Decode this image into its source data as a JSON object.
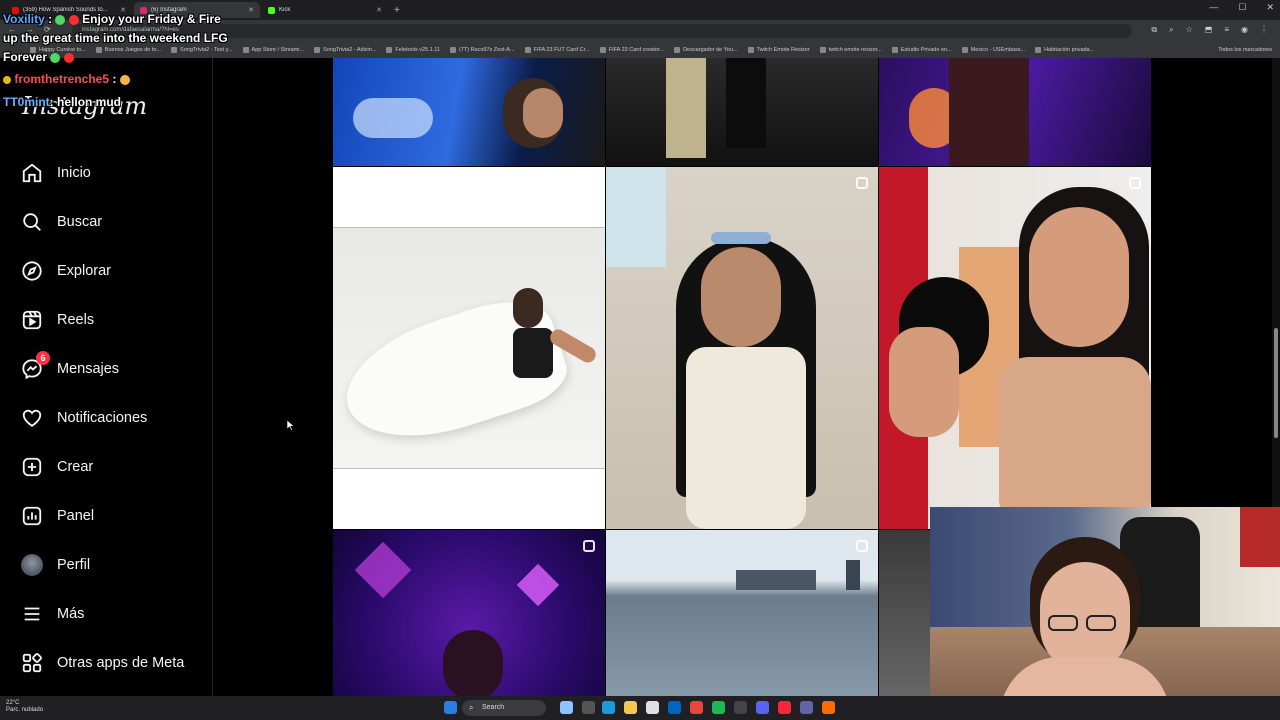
{
  "browser": {
    "tabs": [
      {
        "label": "(359) How Spanish Sounds to...",
        "color": "#ff0000",
        "active": false
      },
      {
        "label": "(6) Instagram",
        "color": "#d62976",
        "active": true
      },
      {
        "label": "Kick",
        "color": "#53fc18",
        "active": false
      }
    ],
    "url": "instagram.com/dafaesalarma/?hl=es",
    "bookmarks": [
      "Happy Cursive to...",
      "Buenos Juegos de to...",
      "SongTrivia2 - Test y...",
      "App Store / Streami...",
      "SongTrivia2 - Adivin...",
      "Feletools v25.1.11",
      "(7T) Raco97s Zest-A...",
      "FIFA 23 FUT Card Cr...",
      "FIFA 23 Card creator...",
      "Descargador de You...",
      "Twitch Emote Resizer",
      "twitch emote resizer...",
      "Estudio Privado en...",
      "Mexico - USEmbass...",
      "Habitación privada..."
    ],
    "bookmarks_end": "Todos los marcadores"
  },
  "instagram": {
    "logo": "Instagram",
    "nav": [
      {
        "label": "Inicio",
        "icon": "home-icon"
      },
      {
        "label": "Buscar",
        "icon": "search-icon"
      },
      {
        "label": "Explorar",
        "icon": "compass-icon"
      },
      {
        "label": "Reels",
        "icon": "reels-icon"
      },
      {
        "label": "Mensajes",
        "icon": "messenger-icon",
        "badge": "6"
      },
      {
        "label": "Notificaciones",
        "icon": "heart-icon"
      },
      {
        "label": "Crear",
        "icon": "plus-square-icon"
      },
      {
        "label": "Panel",
        "icon": "chart-icon"
      },
      {
        "label": "Perfil",
        "icon": "avatar-icon"
      },
      {
        "label": "Más",
        "icon": "menu-icon"
      },
      {
        "label": "Otras apps de Meta",
        "icon": "meta-apps-icon"
      }
    ]
  },
  "chat": [
    {
      "user": "Voxility",
      "message": "Enjoy your Friday & Fire up the great time into the weekend LFG Forever"
    },
    {
      "user": "fromthetrenche5",
      "message": ""
    },
    {
      "user": "TT0mint",
      "message": "hellon mud"
    }
  ],
  "taskbar": {
    "weather_temp": "22°C",
    "weather_desc": "Parc. nublado",
    "search_label": "Search"
  },
  "colors": {
    "accent": "#ff3040",
    "background": "#000000"
  }
}
